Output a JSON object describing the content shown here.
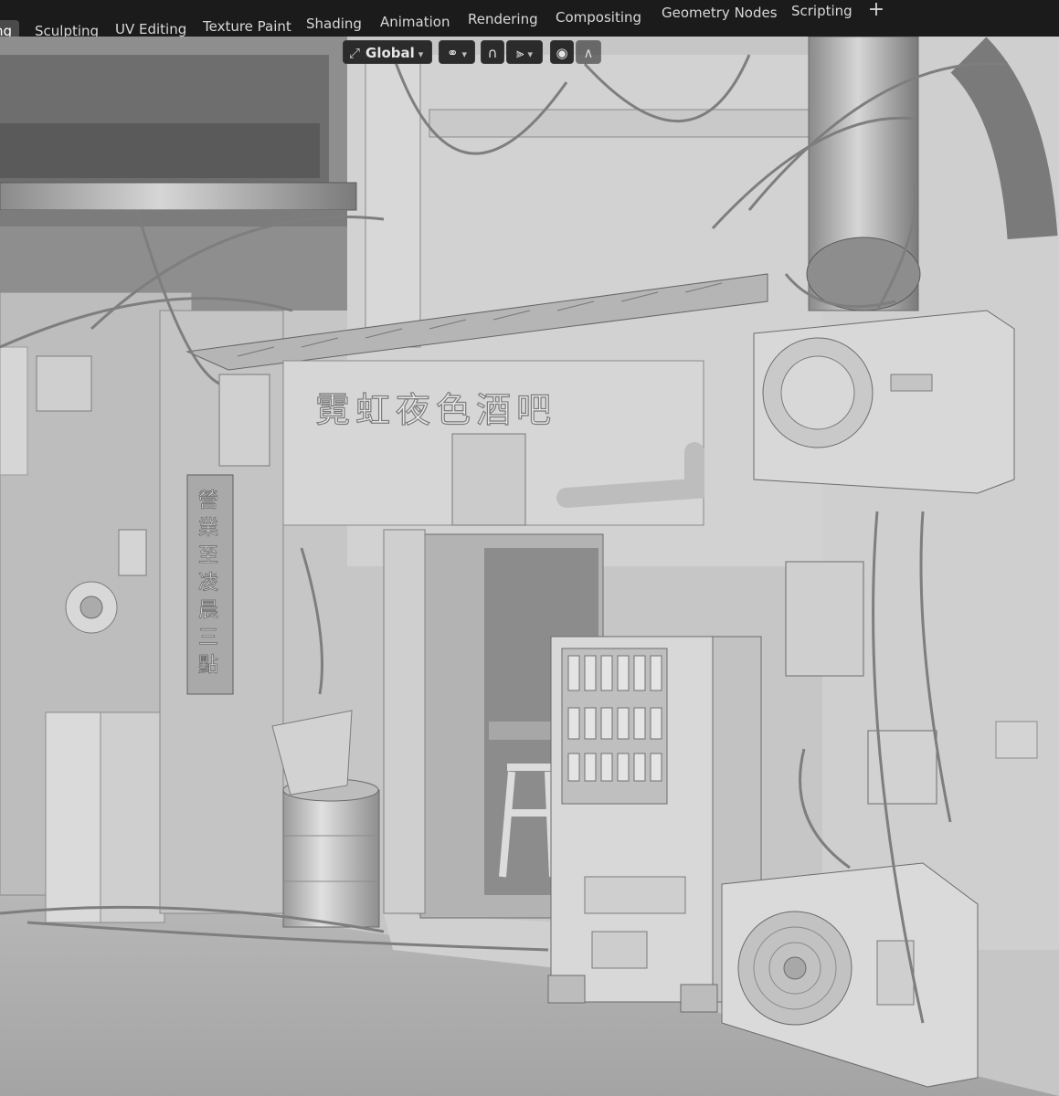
{
  "workspace_tabs": [
    {
      "label": "ng",
      "active": true
    },
    {
      "label": "Sculpting",
      "active": false
    },
    {
      "label": "UV Editing",
      "active": false
    },
    {
      "label": "Texture Paint",
      "active": false
    },
    {
      "label": "Shading",
      "active": false
    },
    {
      "label": "Animation",
      "active": false
    },
    {
      "label": "Rendering",
      "active": false
    },
    {
      "label": "Compositing",
      "active": false
    },
    {
      "label": "Geometry Nodes",
      "active": false
    },
    {
      "label": "Scripting",
      "active": false
    }
  ],
  "add_workspace_label": "+",
  "viewport_header": {
    "transform_orientation": "Global"
  },
  "scene": {
    "shop_sign": "霓虹夜色酒吧",
    "vertical_sign": [
      "營",
      "業",
      "至",
      "凌",
      "晨",
      "三",
      "點"
    ]
  },
  "colors": {
    "ui_bg": "#1b1b1b",
    "tab_active": "#4a4a4a",
    "viewport_clay": "#c9c9c9"
  }
}
